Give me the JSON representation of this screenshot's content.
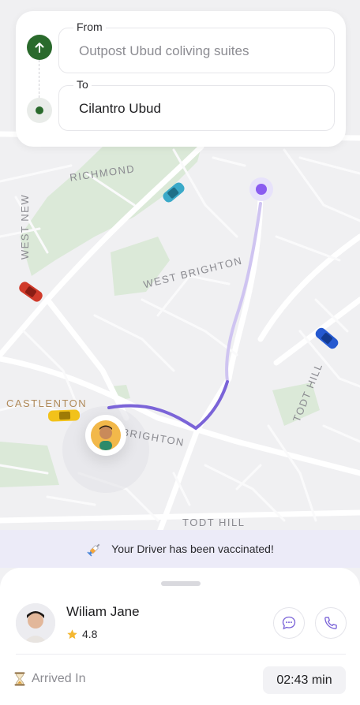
{
  "route": {
    "from_label": "From",
    "from_value": "Outpost Ubud coliving suites",
    "to_label": "To",
    "to_value": "Cilantro Ubud"
  },
  "map": {
    "labels": {
      "richmond": "RICHMOND",
      "west_new": "WEST NEW",
      "west_brighton": "WEST BRIGHTON",
      "todt_hill_road": "TODT HILL",
      "castlenton": "CASTLENTON",
      "brighton": "BRIGHTON",
      "todt_hill": "TODT HILL"
    },
    "cars": [
      "car-cyan",
      "car-red",
      "car-blue",
      "car-yellow"
    ],
    "route_color": "#7b64d8",
    "destination_color": "#8a5cf0"
  },
  "banner": {
    "text": "Your Driver has been vaccinated!",
    "icon": "syringe-icon"
  },
  "driver": {
    "name": "Wiliam Jane",
    "rating": "4.8",
    "star_icon": "star-icon",
    "chat_icon": "chat-icon",
    "call_icon": "phone-icon"
  },
  "arrival": {
    "label": "Arrived In",
    "icon": "hourglass-icon",
    "time": "02:43 min"
  },
  "colors": {
    "origin": "#2a6a2c",
    "accent": "#7b64d8",
    "banner_bg": "#ecebf8"
  }
}
